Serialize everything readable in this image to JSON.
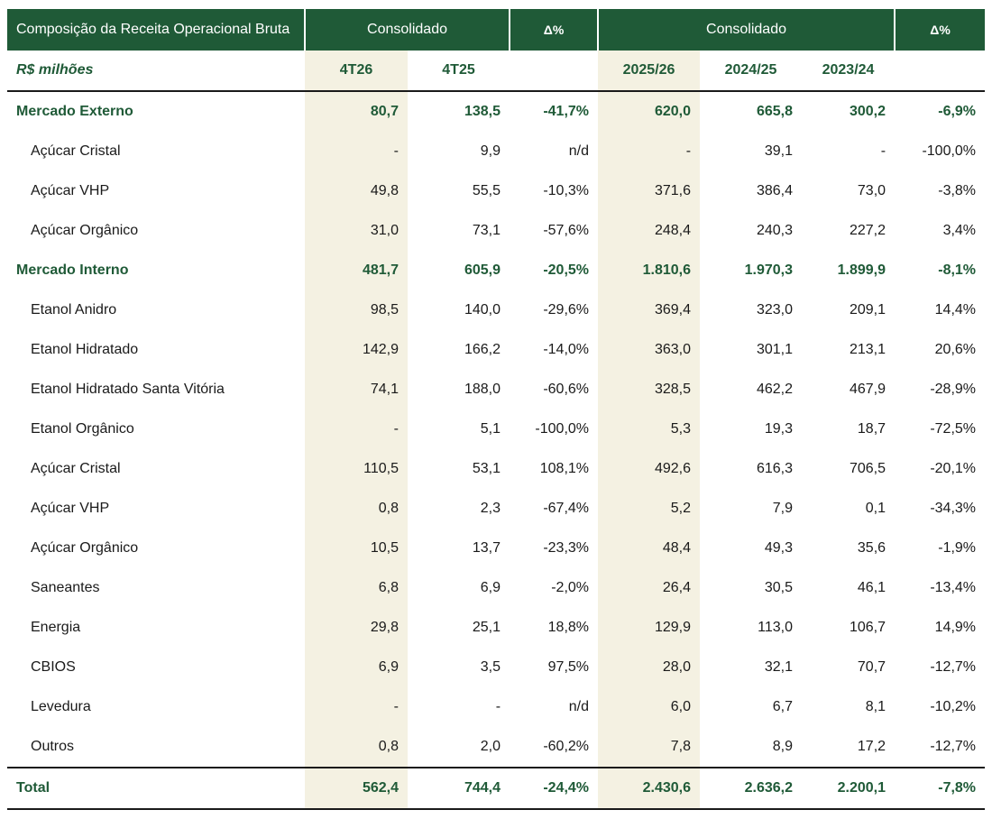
{
  "header": {
    "title": "Composição da Receita Operacional Bruta",
    "group1": "Consolidado",
    "delta1": "Δ%",
    "group2": "Consolidado",
    "delta2": "Δ%",
    "units": "R$ milhões",
    "col_4t26": "4T26",
    "col_4t25": "4T25",
    "col_2526": "2025/26",
    "col_2425": "2024/25",
    "col_2324": "2023/24"
  },
  "rows": [
    {
      "label": "Mercado Externo",
      "type": "section",
      "v": [
        "80,7",
        "138,5",
        "-41,7%",
        "620,0",
        "665,8",
        "300,2",
        "-6,9%"
      ]
    },
    {
      "label": "Açúcar Cristal",
      "type": "sub",
      "v": [
        "-",
        "9,9",
        "n/d",
        "-",
        "39,1",
        "-",
        "-100,0%"
      ]
    },
    {
      "label": "Açúcar VHP",
      "type": "sub",
      "v": [
        "49,8",
        "55,5",
        "-10,3%",
        "371,6",
        "386,4",
        "73,0",
        "-3,8%"
      ]
    },
    {
      "label": "Açúcar Orgânico",
      "type": "sub",
      "v": [
        "31,0",
        "73,1",
        "-57,6%",
        "248,4",
        "240,3",
        "227,2",
        "3,4%"
      ]
    },
    {
      "label": "Mercado Interno",
      "type": "section",
      "v": [
        "481,7",
        "605,9",
        "-20,5%",
        "1.810,6",
        "1.970,3",
        "1.899,9",
        "-8,1%"
      ]
    },
    {
      "label": "Etanol Anidro",
      "type": "sub",
      "v": [
        "98,5",
        "140,0",
        "-29,6%",
        "369,4",
        "323,0",
        "209,1",
        "14,4%"
      ]
    },
    {
      "label": "Etanol Hidratado",
      "type": "sub",
      "v": [
        "142,9",
        "166,2",
        "-14,0%",
        "363,0",
        "301,1",
        "213,1",
        "20,6%"
      ]
    },
    {
      "label": "Etanol Hidratado Santa Vitória",
      "type": "sub",
      "v": [
        "74,1",
        "188,0",
        "-60,6%",
        "328,5",
        "462,2",
        "467,9",
        "-28,9%"
      ]
    },
    {
      "label": "Etanol Orgânico",
      "type": "sub",
      "v": [
        "-",
        "5,1",
        "-100,0%",
        "5,3",
        "19,3",
        "18,7",
        "-72,5%"
      ]
    },
    {
      "label": "Açúcar Cristal",
      "type": "sub",
      "v": [
        "110,5",
        "53,1",
        "108,1%",
        "492,6",
        "616,3",
        "706,5",
        "-20,1%"
      ]
    },
    {
      "label": "Açúcar VHP",
      "type": "sub",
      "v": [
        "0,8",
        "2,3",
        "-67,4%",
        "5,2",
        "7,9",
        "0,1",
        "-34,3%"
      ]
    },
    {
      "label": "Açúcar Orgânico",
      "type": "sub",
      "v": [
        "10,5",
        "13,7",
        "-23,3%",
        "48,4",
        "49,3",
        "35,6",
        "-1,9%"
      ]
    },
    {
      "label": "Saneantes",
      "type": "sub",
      "v": [
        "6,8",
        "6,9",
        "-2,0%",
        "26,4",
        "30,5",
        "46,1",
        "-13,4%"
      ]
    },
    {
      "label": "Energia",
      "type": "sub",
      "v": [
        "29,8",
        "25,1",
        "18,8%",
        "129,9",
        "113,0",
        "106,7",
        "14,9%"
      ]
    },
    {
      "label": "CBIOS",
      "type": "sub",
      "v": [
        "6,9",
        "3,5",
        "97,5%",
        "28,0",
        "32,1",
        "70,7",
        "-12,7%"
      ]
    },
    {
      "label": "Levedura",
      "type": "sub",
      "v": [
        "-",
        "-",
        "n/d",
        "6,0",
        "6,7",
        "8,1",
        "-10,2%"
      ]
    },
    {
      "label": "Outros",
      "type": "sub",
      "v": [
        "0,8",
        "2,0",
        "-60,2%",
        "7,8",
        "8,9",
        "17,2",
        "-12,7%"
      ]
    }
  ],
  "total": {
    "label": "Total",
    "v": [
      "562,4",
      "744,4",
      "-24,4%",
      "2.430,6",
      "2.636,2",
      "2.200,1",
      "-7,8%"
    ]
  }
}
